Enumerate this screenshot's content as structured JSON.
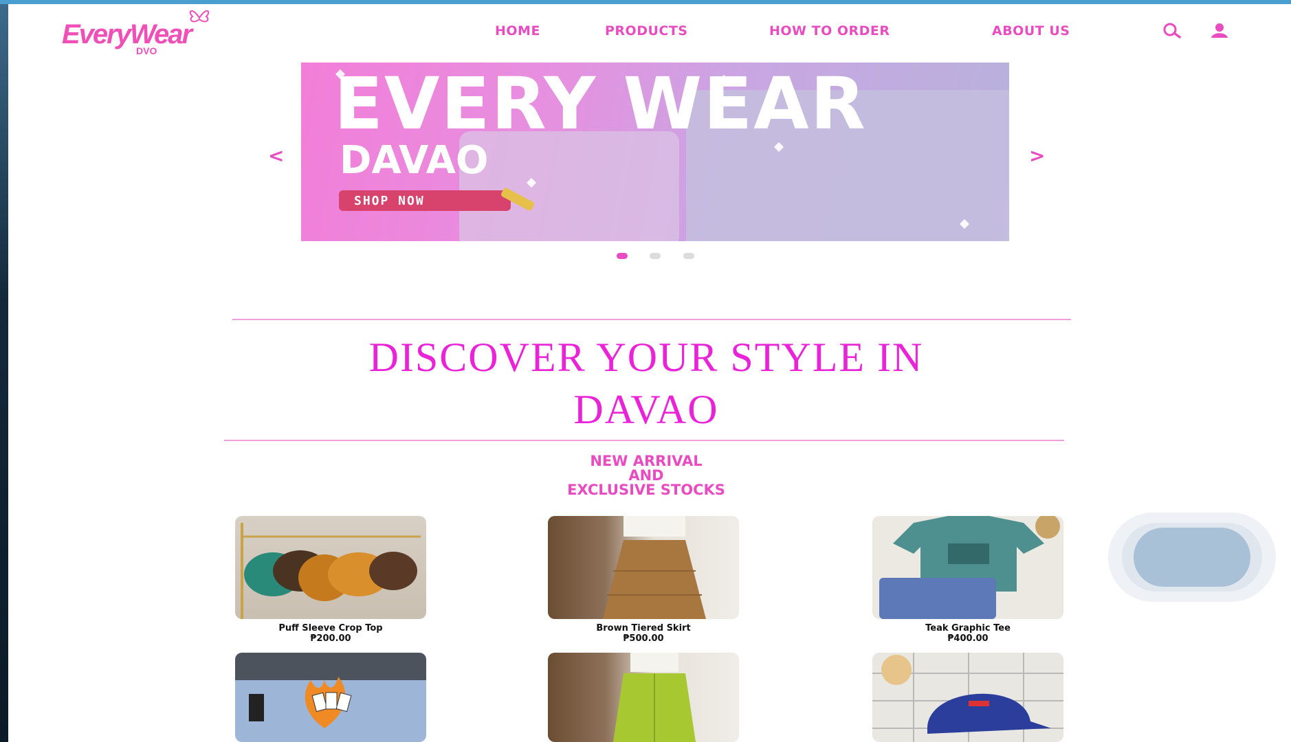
{
  "brand": {
    "name": "EveryWear",
    "sub": "DVO"
  },
  "nav": {
    "items": [
      "HOME",
      "PRODUCTS",
      "HOW TO ORDER",
      "ABOUT US"
    ]
  },
  "icons": {
    "search": "search-icon",
    "account": "user-icon"
  },
  "hero": {
    "title": "EVERY WEAR",
    "subtitle": "DAVAO",
    "cta": "SHOP NOW",
    "prev": "<",
    "next": ">",
    "slide_count": 3,
    "active_slide": 1
  },
  "section": {
    "headline_line1": "DISCOVER YOUR STYLE IN",
    "headline_line2": "DAVAO",
    "subhead_line1": "NEW ARRIVAL",
    "subhead_line2": "AND",
    "subhead_line3": "EXCLUSIVE STOCKS"
  },
  "products": [
    {
      "name": "Puff Sleeve Crop Top",
      "price": "₱200.00"
    },
    {
      "name": "Brown Tiered Skirt",
      "price": "₱500.00"
    },
    {
      "name": "Teak Graphic Tee",
      "price": "₱400.00"
    },
    {
      "name": "",
      "price": ""
    },
    {
      "name": "",
      "price": ""
    },
    {
      "name": "",
      "price": ""
    }
  ],
  "colors": {
    "brand_pink": "#e94bc0",
    "headline_magenta": "#ea22d8",
    "top_strip": "#4a9fd0"
  }
}
